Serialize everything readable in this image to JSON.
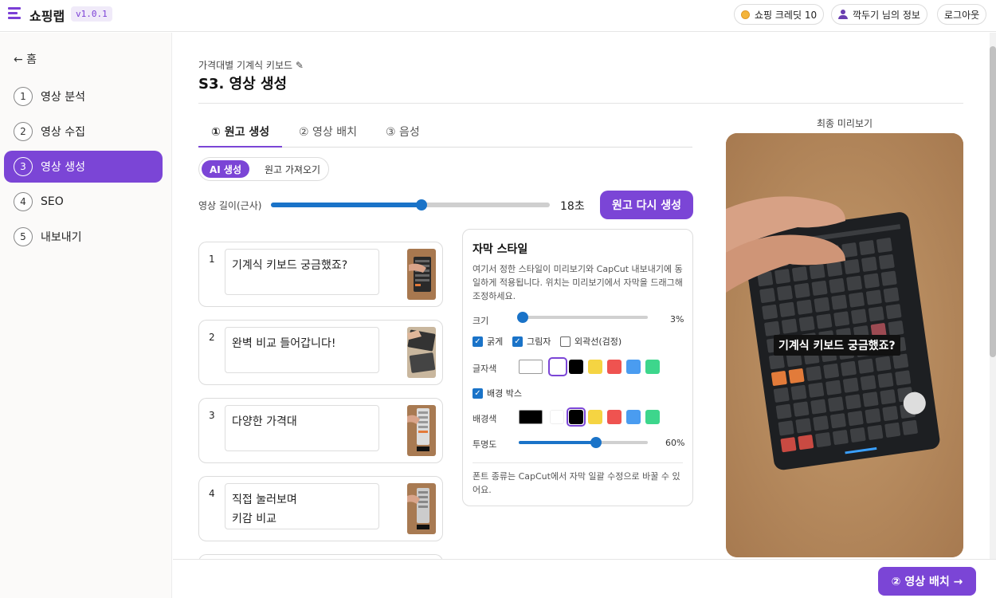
{
  "app": {
    "name": "쇼핑랩",
    "version": "v1.0.1"
  },
  "header": {
    "credit_label": "쇼핑 크레딧 10",
    "user_label": "깍두기 님의 정보",
    "logout_label": "로그아웃"
  },
  "sidebar": {
    "home_label": "← 홈",
    "steps": [
      {
        "num": "1",
        "label": "영상 분석"
      },
      {
        "num": "2",
        "label": "영상 수집"
      },
      {
        "num": "3",
        "label": "영상 생성"
      },
      {
        "num": "4",
        "label": "SEO"
      },
      {
        "num": "5",
        "label": "내보내기"
      }
    ],
    "active_step": 3
  },
  "page": {
    "subtitle": "가격대별 기계식 키보드 ✎",
    "title": "S3. 영상 생성"
  },
  "tabs": [
    {
      "label": "① 원고 생성"
    },
    {
      "label": "② 영상 배치"
    },
    {
      "label": "③ 음성"
    }
  ],
  "mode": {
    "ai_label": "AI 생성",
    "import_label": "원고 가져오기"
  },
  "length": {
    "label": "영상 길이(근사)",
    "value_text": "18초",
    "fraction": 0.54
  },
  "regen_label": "원고 다시 생성",
  "scripts": [
    {
      "num": "1",
      "text": "기계식 키보드 궁금했죠?"
    },
    {
      "num": "2",
      "text": "완벽 비교 들어갑니다!"
    },
    {
      "num": "3",
      "text": "다양한 가격대"
    },
    {
      "num": "4",
      "line1": "직접 눌러보며",
      "line2": "키감 비교"
    }
  ],
  "subtitle_style": {
    "title": "자막 스타일",
    "desc": "여기서 정한 스타일이 미리보기와 CapCut 내보내기에 동일하게 적용됩니다. 위치는 미리보기에서 자막을 드래그해 조정하세요.",
    "size_label": "크기",
    "size_value": "3%",
    "size_fraction": 0.0,
    "bold_label": "굵게",
    "shadow_label": "그림자",
    "outline_label": "외곽선(검정)",
    "text_color_label": "글자색",
    "bg_box_label": "배경 박스",
    "bg_color_label": "배경색",
    "opacity_label": "투명도",
    "opacity_value": "60%",
    "opacity_fraction": 0.6,
    "footnote": "폰트 종류는 CapCut에서 자막 일괄 수정으로 바꿀 수 있어요.",
    "swatches": [
      "#ffffff",
      "#000000",
      "#f5d442",
      "#ef5350",
      "#4a9cf0",
      "#3dd68c"
    ]
  },
  "preview": {
    "label": "최종 미리보기",
    "caption": "기계식 키보드 궁금했죠?"
  },
  "next_label": "② 영상 배치 →",
  "colors": {
    "accent": "#7b45d6",
    "slider": "#1a73c8"
  }
}
